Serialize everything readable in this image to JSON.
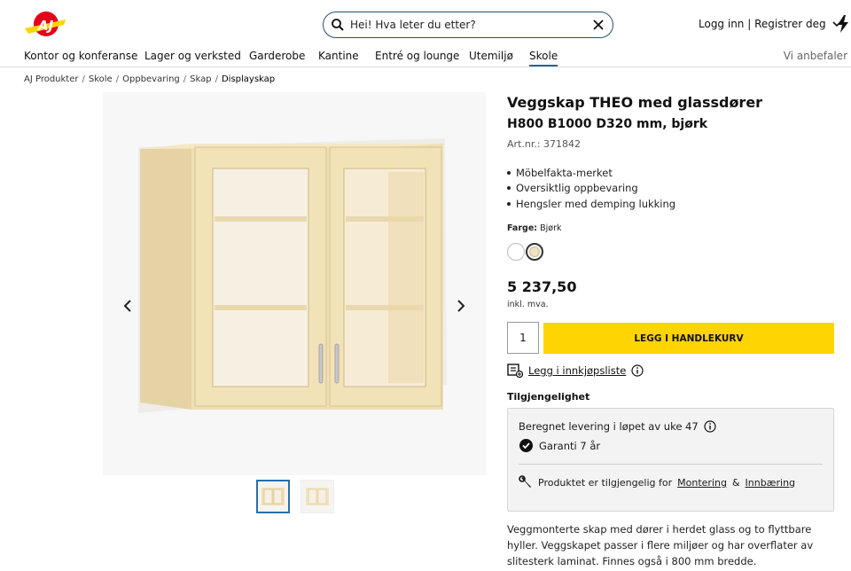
{
  "header": {
    "search_placeholder": "Hei! Hva leter du etter?",
    "account_label": "Logg inn | Registrer deg"
  },
  "nav": {
    "items": [
      {
        "label": "Kontor og konferanse"
      },
      {
        "label": "Lager og verksted"
      },
      {
        "label": "Garderobe"
      },
      {
        "label": "Kantine"
      },
      {
        "label": "Entré og lounge"
      },
      {
        "label": "Utemiljø"
      },
      {
        "label": "Skole",
        "active": true
      }
    ],
    "right_label": "Vi anbefaler"
  },
  "breadcrumb": [
    "AJ Produkter",
    "Skole",
    "Oppbevaring",
    "Skap",
    "Displayskap"
  ],
  "product": {
    "title": "Veggskap THEO med glassdører",
    "subtitle": "H800 B1000 D320 mm, bjørk",
    "article": "Art.nr.: 371842",
    "features": [
      "Möbelfakta-merket",
      "Oversiktlig oppbevaring",
      "Hengsler med demping lukking"
    ],
    "color_label": "Farge:",
    "color_value": "Bjørk",
    "swatches": [
      {
        "name": "white",
        "color": "#ffffff"
      },
      {
        "name": "birch",
        "color": "#efe3c4",
        "selected": true
      }
    ],
    "price": "5 237,50",
    "vat": "inkl. mva.",
    "quantity": "1",
    "add_to_cart": "LEGG I HANDLEKURV",
    "wishlist": "Legg i innkjøpsliste",
    "availability_heading": "Tilgjengelighet",
    "delivery": "Beregnet levering i løpet av uke 47",
    "warranty": "Garanti 7 år",
    "service_prefix": "Produktet er tilgjengelig for",
    "service_link1": "Montering",
    "service_amp": "&",
    "service_link2": "Innbæring",
    "description": "Veggmonterte skap med dører i herdet glass og to flyttbare hyller. Veggskapet passer i flere miljøer og har overflater av slitesterk laminat. Finnes også i 800 mm bredde."
  },
  "colors": {
    "accent_yellow": "#ffd400",
    "nav_active": "#1f6aa5",
    "logo_red": "#e3001b"
  }
}
